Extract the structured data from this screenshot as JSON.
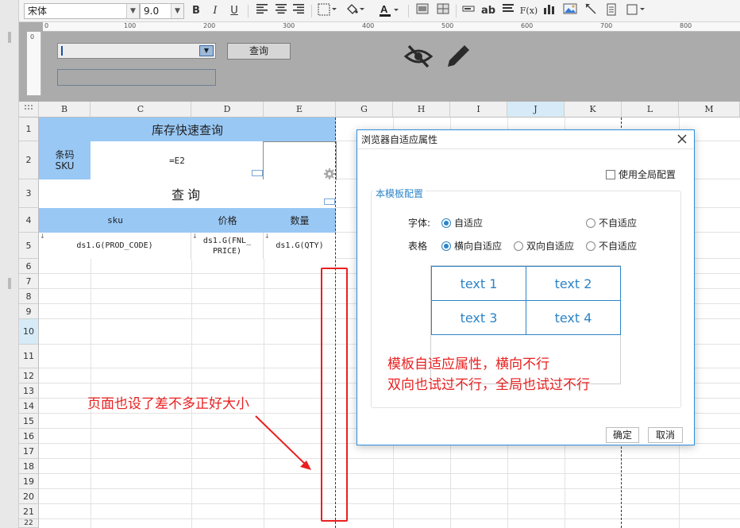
{
  "toolbar": {
    "font_name": "宋体",
    "font_size": "9.0",
    "bold": "B",
    "italic": "I",
    "underline": "U",
    "text_tool": "ab",
    "formula_tool": "F(x)"
  },
  "designer": {
    "ruler_labels": [
      "0",
      "100",
      "200",
      "300",
      "400",
      "500",
      "600",
      "700",
      "800"
    ],
    "query_button": "查询",
    "left_ruler_label": "0"
  },
  "grid": {
    "columns": [
      "B",
      "C",
      "D",
      "E",
      "G",
      "H",
      "I",
      "J",
      "K",
      "L",
      "M"
    ],
    "rows": [
      "1",
      "2",
      "3",
      "4",
      "5",
      "6",
      "7",
      "8",
      "9",
      "10",
      "11",
      "12",
      "13",
      "14",
      "15",
      "16",
      "17",
      "18",
      "19",
      "20",
      "21",
      "22"
    ],
    "title": "库存快速查询",
    "barcode_label": "条码\nSKU",
    "formula_cell": "=E2",
    "query_label": "查询",
    "header_sku": "sku",
    "header_price": "价格",
    "header_qty": "数量",
    "ds_code": "ds1.G(PROD_CODE)",
    "ds_price": "ds1.G(FNL_\nPRICE)",
    "ds_qty": "ds1.G(QTY)",
    "annotation": "页面也设了差不多正好大小"
  },
  "dialog": {
    "title": "浏览器自适应属性",
    "use_global": "使用全局配置",
    "group_title": "本模板配置",
    "font_label": "字体:",
    "font_options": [
      "自适应",
      "不自适应"
    ],
    "table_label": "表格",
    "table_options": [
      "横向自适应",
      "双向自适应",
      "不自适应"
    ],
    "preview": [
      "text 1",
      "text 2",
      "text 3",
      "text 4"
    ],
    "annotation_line1": "模板自适应属性，横向不行",
    "annotation_line2": "双向也试过不行，全局也试过不行",
    "ok": "确定",
    "cancel": "取消"
  }
}
